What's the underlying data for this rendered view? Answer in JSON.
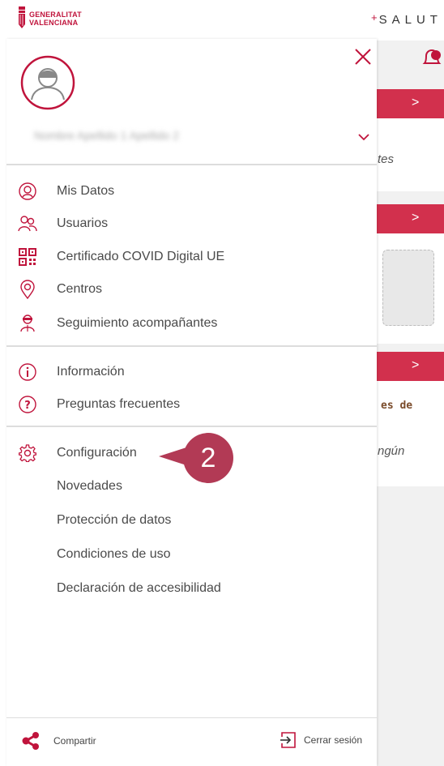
{
  "header": {
    "logo_line1": "GENERALITAT",
    "logo_line2": "VALENCIANA",
    "brand_plus": "+",
    "brand": "SALUT"
  },
  "background": {
    "text1": "tes",
    "text2": "es de",
    "text3": "ngún",
    "chevron": ">"
  },
  "user": {
    "name": "Nombre Apellido 1 Apellido 2"
  },
  "menu": {
    "group1": [
      {
        "label": "Mis Datos",
        "icon": "user-circle-icon"
      },
      {
        "label": "Usuarios",
        "icon": "users-icon"
      },
      {
        "label": "Certificado COVID Digital UE",
        "icon": "qr-code-icon"
      },
      {
        "label": "Centros",
        "icon": "location-pin-icon"
      },
      {
        "label": "Seguimiento acompañantes",
        "icon": "companion-icon"
      }
    ],
    "group2": [
      {
        "label": "Información",
        "icon": "info-icon"
      },
      {
        "label": "Preguntas frecuentes",
        "icon": "question-icon"
      }
    ],
    "settings": {
      "label": "Configuración",
      "icon": "gear-icon"
    },
    "sub": [
      "Novedades",
      "Protección de datos",
      "Condiciones de uso",
      "Declaración de accesibilidad"
    ]
  },
  "callout": {
    "number": "2"
  },
  "footer": {
    "share": "Compartir",
    "logout": "Cerrar sesión"
  },
  "colors": {
    "accent": "#c0143c",
    "callout": "#b23a55",
    "button": "#d2304d"
  }
}
